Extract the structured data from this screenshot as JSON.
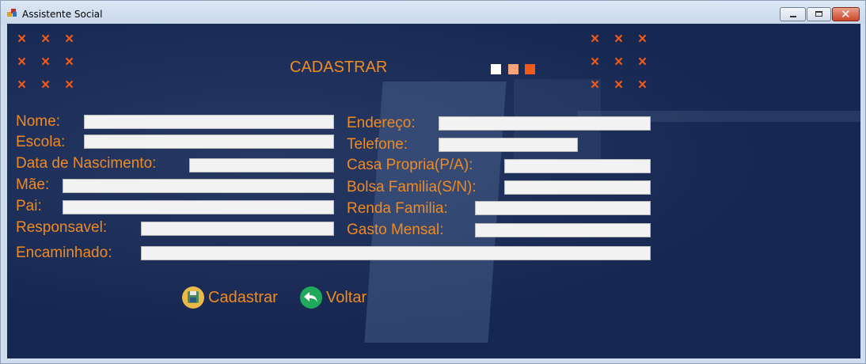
{
  "window": {
    "title": "Assistente Social",
    "controls": {
      "minimize": "minimize",
      "maximize": "maximize",
      "close": "close"
    }
  },
  "header": {
    "title": "CADASTRAR",
    "decor_mark": "×",
    "squares": [
      "#ffffff",
      "#f4a37a",
      "#f05a1a"
    ]
  },
  "form": {
    "left": [
      {
        "label": "Nome:",
        "value": ""
      },
      {
        "label": "Escola:",
        "value": ""
      },
      {
        "label": "Data de Nascimento:",
        "value": ""
      },
      {
        "label": "Mãe:",
        "value": ""
      },
      {
        "label": "Pai:",
        "value": ""
      },
      {
        "label": "Responsavel:",
        "value": ""
      }
    ],
    "right": [
      {
        "label": "Endereço:",
        "value": ""
      },
      {
        "label": "Telefone:",
        "value": ""
      },
      {
        "label": "Casa Propria(P/A):",
        "value": ""
      },
      {
        "label": "Bolsa Familia(S/N):",
        "value": ""
      },
      {
        "label": "Renda Familia:",
        "value": ""
      },
      {
        "label": "Gasto Mensal:",
        "value": ""
      }
    ],
    "full": {
      "label": "Encaminhado:",
      "value": ""
    }
  },
  "actions": {
    "register_label": "Cadastrar",
    "back_label": "Voltar"
  },
  "colors": {
    "background": "#162852",
    "accent": "#f08a22",
    "mark": "#f05a1a",
    "field": "#f2f2f2"
  },
  "icons": {
    "register": "floppy-disk-icon",
    "back": "back-arrow-icon"
  }
}
